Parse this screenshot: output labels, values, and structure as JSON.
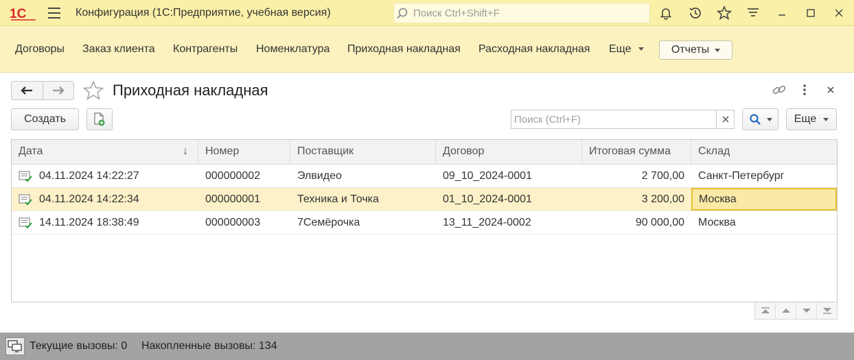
{
  "titlebar": {
    "title": "Конфигурация  (1С:Предприятие, учебная версия)",
    "search_placeholder": "Поиск Ctrl+Shift+F",
    "logo_text": "1С",
    "icons": [
      "bell-icon",
      "history-icon",
      "star-icon",
      "filter-icon",
      "minimize-icon",
      "maximize-icon",
      "close-icon"
    ]
  },
  "nav": {
    "items": [
      "Договоры",
      "Заказ клиента",
      "Контрагенты",
      "Номенклатура",
      "Приходная накладная",
      "Расходная накладная"
    ],
    "more_label": "Еще",
    "reports_label": "Отчеты"
  },
  "form": {
    "title": "Приходная накладная",
    "create_label": "Создать",
    "search_placeholder": "Поиск (Ctrl+F)",
    "more_label": "Еще"
  },
  "table": {
    "columns": [
      "Дата",
      "Номер",
      "Поставщик",
      "Договор",
      "Итоговая сумма",
      "Склад"
    ],
    "rows": [
      {
        "date": "04.11.2024 14:22:27",
        "number": "000000002",
        "supplier": "Элвидео",
        "contract": "09_10_2024-0001",
        "total": "2 700,00",
        "warehouse": "Санкт-Петербург"
      },
      {
        "date": "04.11.2024 14:22:34",
        "number": "000000001",
        "supplier": "Техника и Точка",
        "contract": "01_10_2024-0001",
        "total": "3 200,00",
        "warehouse": "Москва"
      },
      {
        "date": "14.11.2024 18:38:49",
        "number": "000000003",
        "supplier": "7Семёрочка",
        "contract": "13_11_2024-0002",
        "total": "90 000,00",
        "warehouse": "Москва"
      }
    ],
    "selected_row": 1,
    "sort_indicator": "↓"
  },
  "status": {
    "current_calls": "Текущие вызовы: 0",
    "accumulated_calls": "Накопленные вызовы: 134"
  },
  "colors": {
    "title_bg": "#fbf0a8",
    "nav_bg": "#fbf2bf",
    "selected_row_bg": "#fcf1c8",
    "active_cell_border": "#e6c02a",
    "status_bg": "#a3a3a3",
    "logo_red": "#d9262b"
  }
}
